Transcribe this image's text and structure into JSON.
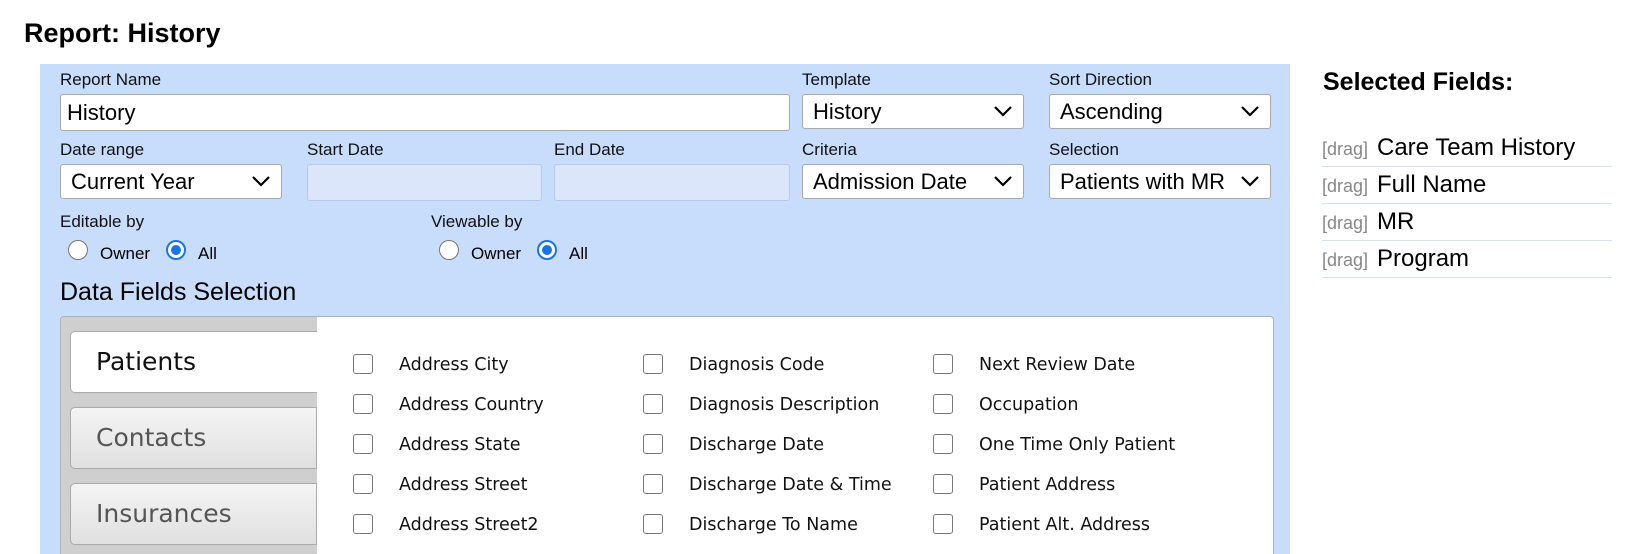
{
  "page": {
    "title": "Report: History"
  },
  "form": {
    "report_name": {
      "label": "Report Name",
      "value": "History"
    },
    "template": {
      "label": "Template",
      "value": "History"
    },
    "sort_direction": {
      "label": "Sort Direction",
      "value": "Ascending"
    },
    "date_range": {
      "label": "Date range",
      "value": "Current Year"
    },
    "start_date": {
      "label": "Start Date",
      "value": ""
    },
    "end_date": {
      "label": "End Date",
      "value": ""
    },
    "criteria": {
      "label": "Criteria",
      "value": "Admission Date"
    },
    "selection": {
      "label": "Selection",
      "value": "Patients with MR"
    },
    "editable_by": {
      "label": "Editable by",
      "options": [
        "Owner",
        "All"
      ],
      "selected": "All"
    },
    "viewable_by": {
      "label": "Viewable by",
      "options": [
        "Owner",
        "All"
      ],
      "selected": "All"
    },
    "accent_color": "#1a73e8",
    "panel_color": "#c8dcfb"
  },
  "data_fields": {
    "title": "Data Fields Selection",
    "tabs": [
      {
        "label": "Patients",
        "active": true
      },
      {
        "label": "Contacts",
        "active": false
      },
      {
        "label": "Insurances",
        "active": false
      }
    ],
    "columns": [
      [
        "Address City",
        "Address Country",
        "Address State",
        "Address Street",
        "Address Street2"
      ],
      [
        "Diagnosis Code",
        "Diagnosis Description",
        "Discharge Date",
        "Discharge Date & Time",
        "Discharge To Name"
      ],
      [
        "Next Review Date",
        "Occupation",
        "One Time Only Patient",
        "Patient Address",
        "Patient Alt. Address"
      ]
    ]
  },
  "selected_fields": {
    "title": "Selected Fields:",
    "drag_label": "[drag]",
    "items": [
      "Care Team History",
      "Full Name",
      "MR",
      "Program"
    ]
  }
}
